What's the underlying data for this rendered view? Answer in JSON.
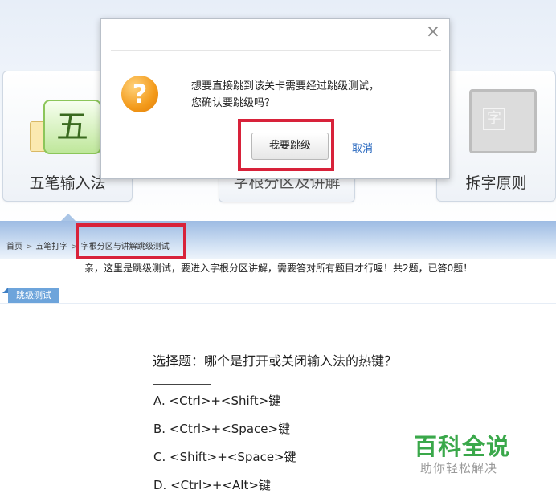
{
  "categories": [
    {
      "label": "五笔输入法",
      "icon": "wubi-icon",
      "icon_char": "五"
    },
    {
      "label": "字根分区及讲解"
    },
    {
      "label": "拆字原则",
      "icon": "chalkboard-icon",
      "icon_char": "字"
    }
  ],
  "breadcrumb": {
    "home": "首页",
    "separator": ">",
    "section": "五笔打字",
    "current": "字根分区与讲解跳级测试"
  },
  "notice": "亲，这里是跳级测试，要进入字根分区讲解，需要答对所有题目才行喔！共2题，已答0题！",
  "test_tab": "跳级测试",
  "question": {
    "text": "选择题：哪个是打开或关闭输入法的热键？",
    "options": [
      "A. <Ctrl>+<Shift>键",
      "B. <Ctrl>+<Space>键",
      "C. <Shift>+<Space>键",
      "D. <Ctrl>+<Alt>键"
    ]
  },
  "dialog": {
    "close_icon": "×",
    "icon": "question-icon",
    "icon_char": "?",
    "message_line1": "想要直接跳到该关卡需要经过跳级测试，",
    "message_line2": "您确认要跳级吗？",
    "confirm_label": "我要跳级",
    "cancel_label": "取消"
  },
  "watermark": {
    "title": "百科全说",
    "subtitle": "助你轻松解决"
  },
  "colors": {
    "highlight_red": "#d8223a",
    "tab_blue": "#6da4db",
    "link_blue": "#2d6bc0",
    "watermark_green": "#3aa84a",
    "question_icon_orange": "#f39a1a"
  }
}
